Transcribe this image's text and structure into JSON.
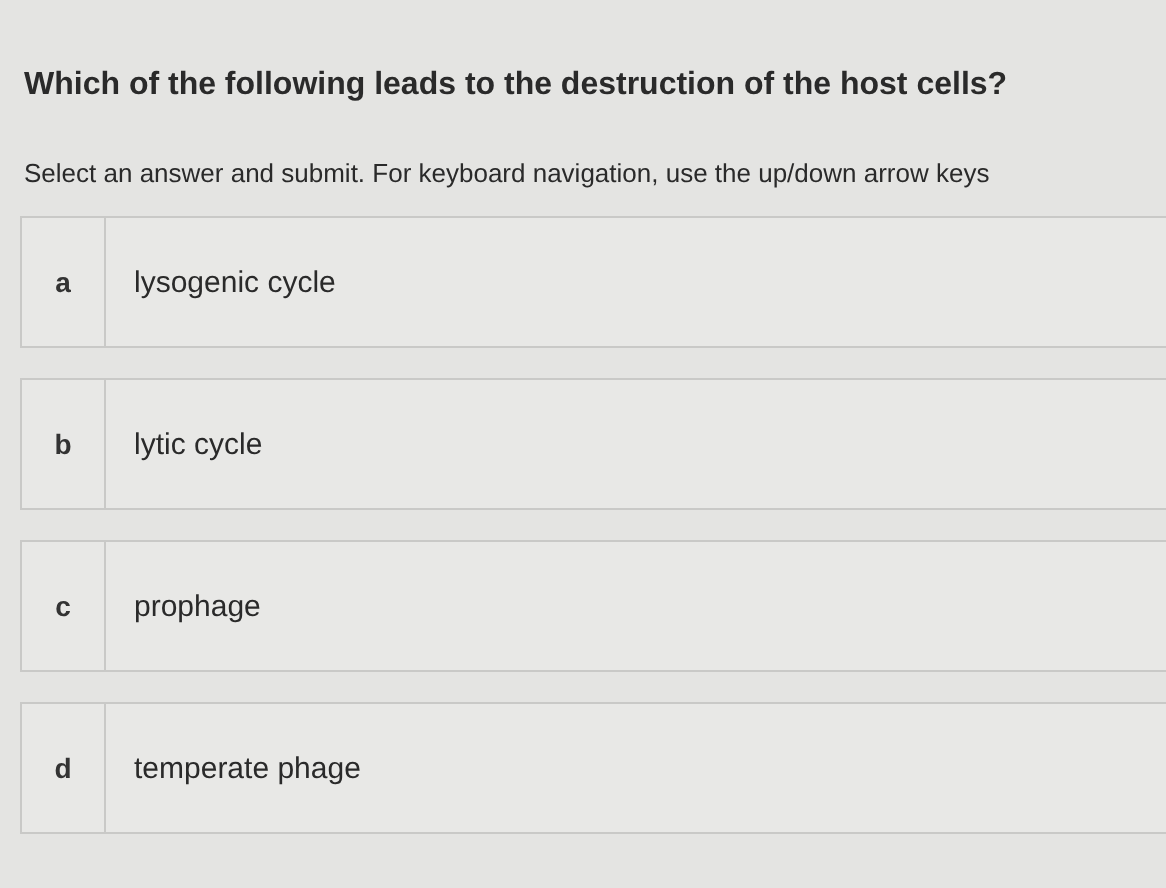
{
  "question": "Which of the following leads to the destruction of the host cells?",
  "instructions": "Select an answer and submit. For keyboard navigation, use the up/down arrow keys",
  "options": [
    {
      "letter": "a",
      "text": "lysogenic cycle",
      "selected": false
    },
    {
      "letter": "b",
      "text": "lytic cycle",
      "selected": false
    },
    {
      "letter": "c",
      "text": "prophage",
      "selected": false
    },
    {
      "letter": "d",
      "text": "temperate phage",
      "selected": false
    }
  ]
}
